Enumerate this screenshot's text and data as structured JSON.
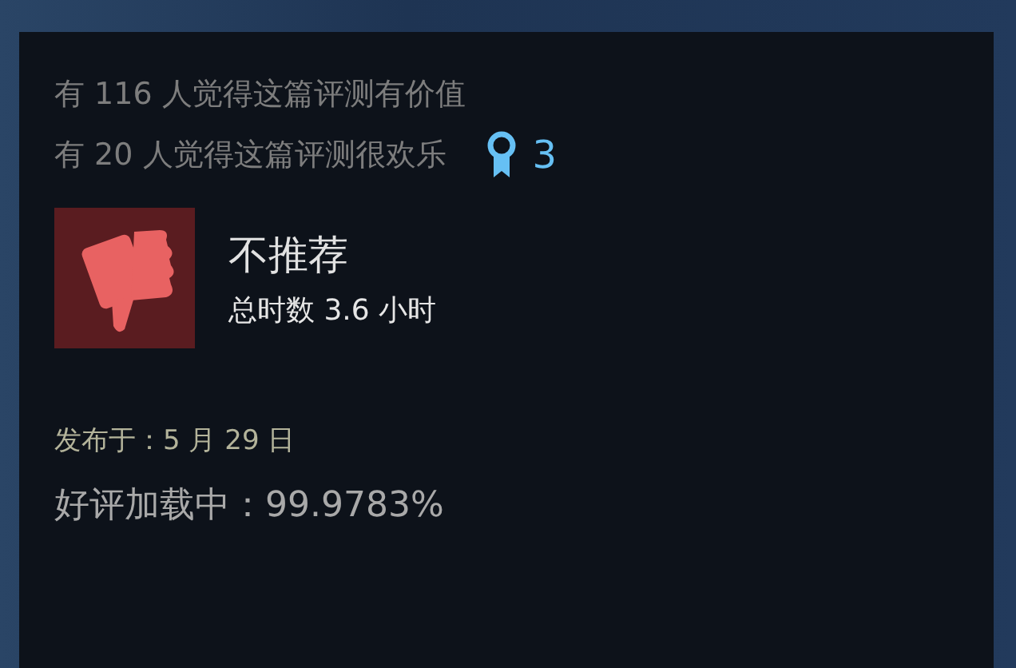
{
  "votes": [
    "有 116 人觉得这篇评测有价值",
    "有 20 人觉得这篇评测很欢乐"
  ],
  "award_count": "3",
  "review": {
    "recommended": false,
    "verdict": "不推荐",
    "hours": "总时数 3.6 小时"
  },
  "posted": "发布于：5 月 29 日",
  "loading": "好评加载中：99.9783%"
}
